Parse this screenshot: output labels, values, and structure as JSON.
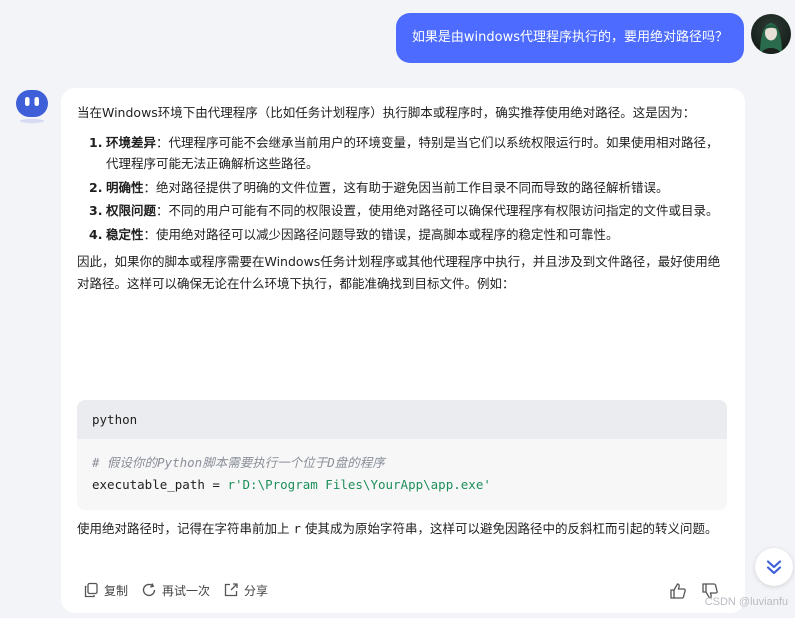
{
  "user_message": {
    "text": "如果是由windows代理程序执行的，要用绝对路径吗？"
  },
  "answer": {
    "intro": "当在Windows环境下由代理程序（比如任务计划程序）执行脚本或程序时，确实推荐使用绝对路径。这是因为：",
    "points": [
      {
        "num": "1.",
        "key": "环境差异",
        "text": "：代理程序可能不会继承当前用户的环境变量，特别是当它们以系统权限运行时。如果使用相对路径，代理程序可能无法正确解析这些路径。"
      },
      {
        "num": "2.",
        "key": "明确性",
        "text": "：绝对路径提供了明确的文件位置，这有助于避免因当前工作目录不同而导致的路径解析错误。"
      },
      {
        "num": "3.",
        "key": "权限问题",
        "text": "：不同的用户可能有不同的权限设置，使用绝对路径可以确保代理程序有权限访问指定的文件或目录。"
      },
      {
        "num": "4.",
        "key": "稳定性",
        "text": "：使用绝对路径可以减少因路径问题导致的错误，提高脚本或程序的稳定性和可靠性。"
      }
    ],
    "conclusion": "因此，如果你的脚本或程序需要在Windows任务计划程序或其他代理程序中执行，并且涉及到文件路径，最好使用绝对路径。这样可以确保无论在什么环境下执行，都能准确找到目标文件。例如：",
    "code": {
      "language": "python",
      "comment": "# 假设你的Python脚本需要执行一个位于D盘的程序",
      "line_var": "executable_path = ",
      "line_str": "r'D:\\Program Files\\YourApp\\app.exe'"
    },
    "tip_before": "使用绝对路径时，记得在字符串前加上 ",
    "tip_code": "r",
    "tip_after": " 使其成为原始字符串，这样可以避免因路径中的反斜杠而引起的转义问题。"
  },
  "actions": {
    "copy": "复制",
    "retry": "再试一次",
    "share": "分享"
  },
  "watermark": "CSDN @luvianfu",
  "colors": {
    "user_bubble": "#4d6cff",
    "bot_avatar": "#3f5fd9",
    "scroll_chevron": "#3f5fd9"
  }
}
